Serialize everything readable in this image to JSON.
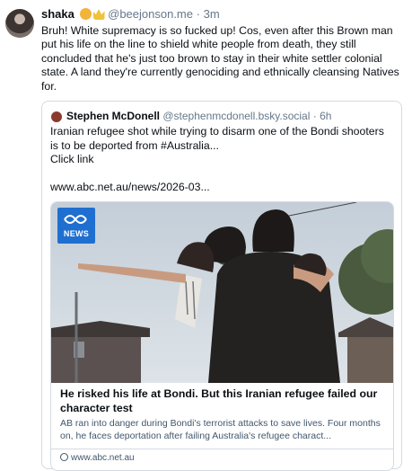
{
  "post": {
    "author_name": "shaka",
    "emoji_1": "lion-emoji",
    "emoji_2": "crown-emoji",
    "handle": "@beejonson.me",
    "separator": "·",
    "time": "3m",
    "text": "Bruh! White supremacy is so fucked up! Cos, even after this Brown man put his life on the line to shield white people from death, they still concluded that he's just too brown to stay in their white settler colonial state. A land they're currently genociding and ethnically cleansing Natives for."
  },
  "quote": {
    "author_name": "Stephen McDonell",
    "handle": "@stephenmcdonell.bsky.social",
    "separator": "·",
    "time": "6h",
    "text": "Iranian refugee shot while trying to disarm one of the Bondi shooters is to be deported from #Australia...\nClick link\n\nwww.abc.net.au/news/2026-03..."
  },
  "link_card": {
    "logo_label": "NEWS",
    "title": "He risked his life at Bondi. But this Iranian refugee failed our character test",
    "description": "AB ran into danger during Bondi's terrorist attacks to save lives. Four months on, he faces deportation after failing Australia's refugee charact...",
    "domain": "www.abc.net.au"
  },
  "colors": {
    "text_primary": "#0b0f14",
    "text_secondary": "#66788a",
    "border": "#d4dbe2",
    "abc_blue": "#1f6fd1"
  }
}
